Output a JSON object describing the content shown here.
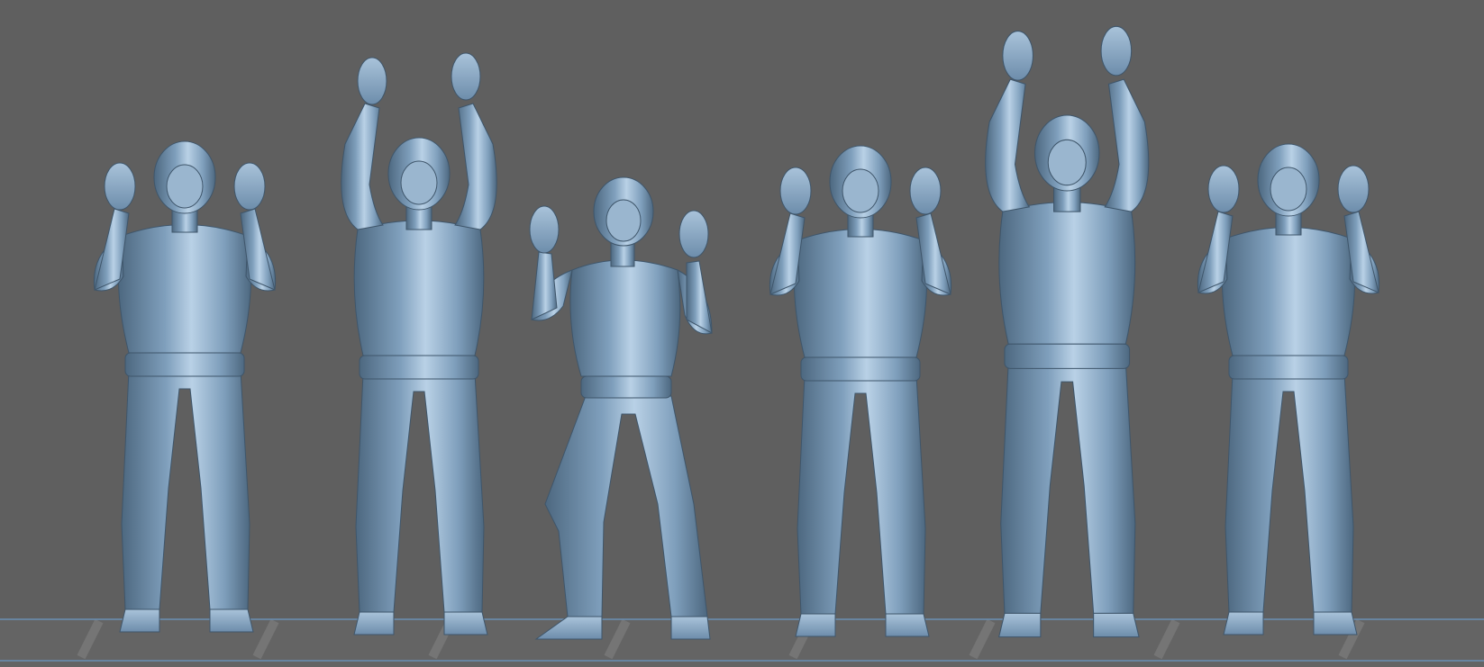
{
  "viewport": {
    "background_color": "#5f5f5f",
    "model_color": "#7f9fbc",
    "model_highlight": "#b9d1e6",
    "model_shadow": "#4d6880",
    "floor_line_color": "#6a8fb3",
    "floor_stripe_color": "#7a7a7a"
  },
  "figures": [
    {
      "pose": "hands-raised-shoulder"
    },
    {
      "pose": "arms-up-high"
    },
    {
      "pose": "crouch-hands-raised"
    },
    {
      "pose": "hands-raised-shoulder"
    },
    {
      "pose": "arms-up-high"
    },
    {
      "pose": "hands-raised-shoulder"
    }
  ]
}
